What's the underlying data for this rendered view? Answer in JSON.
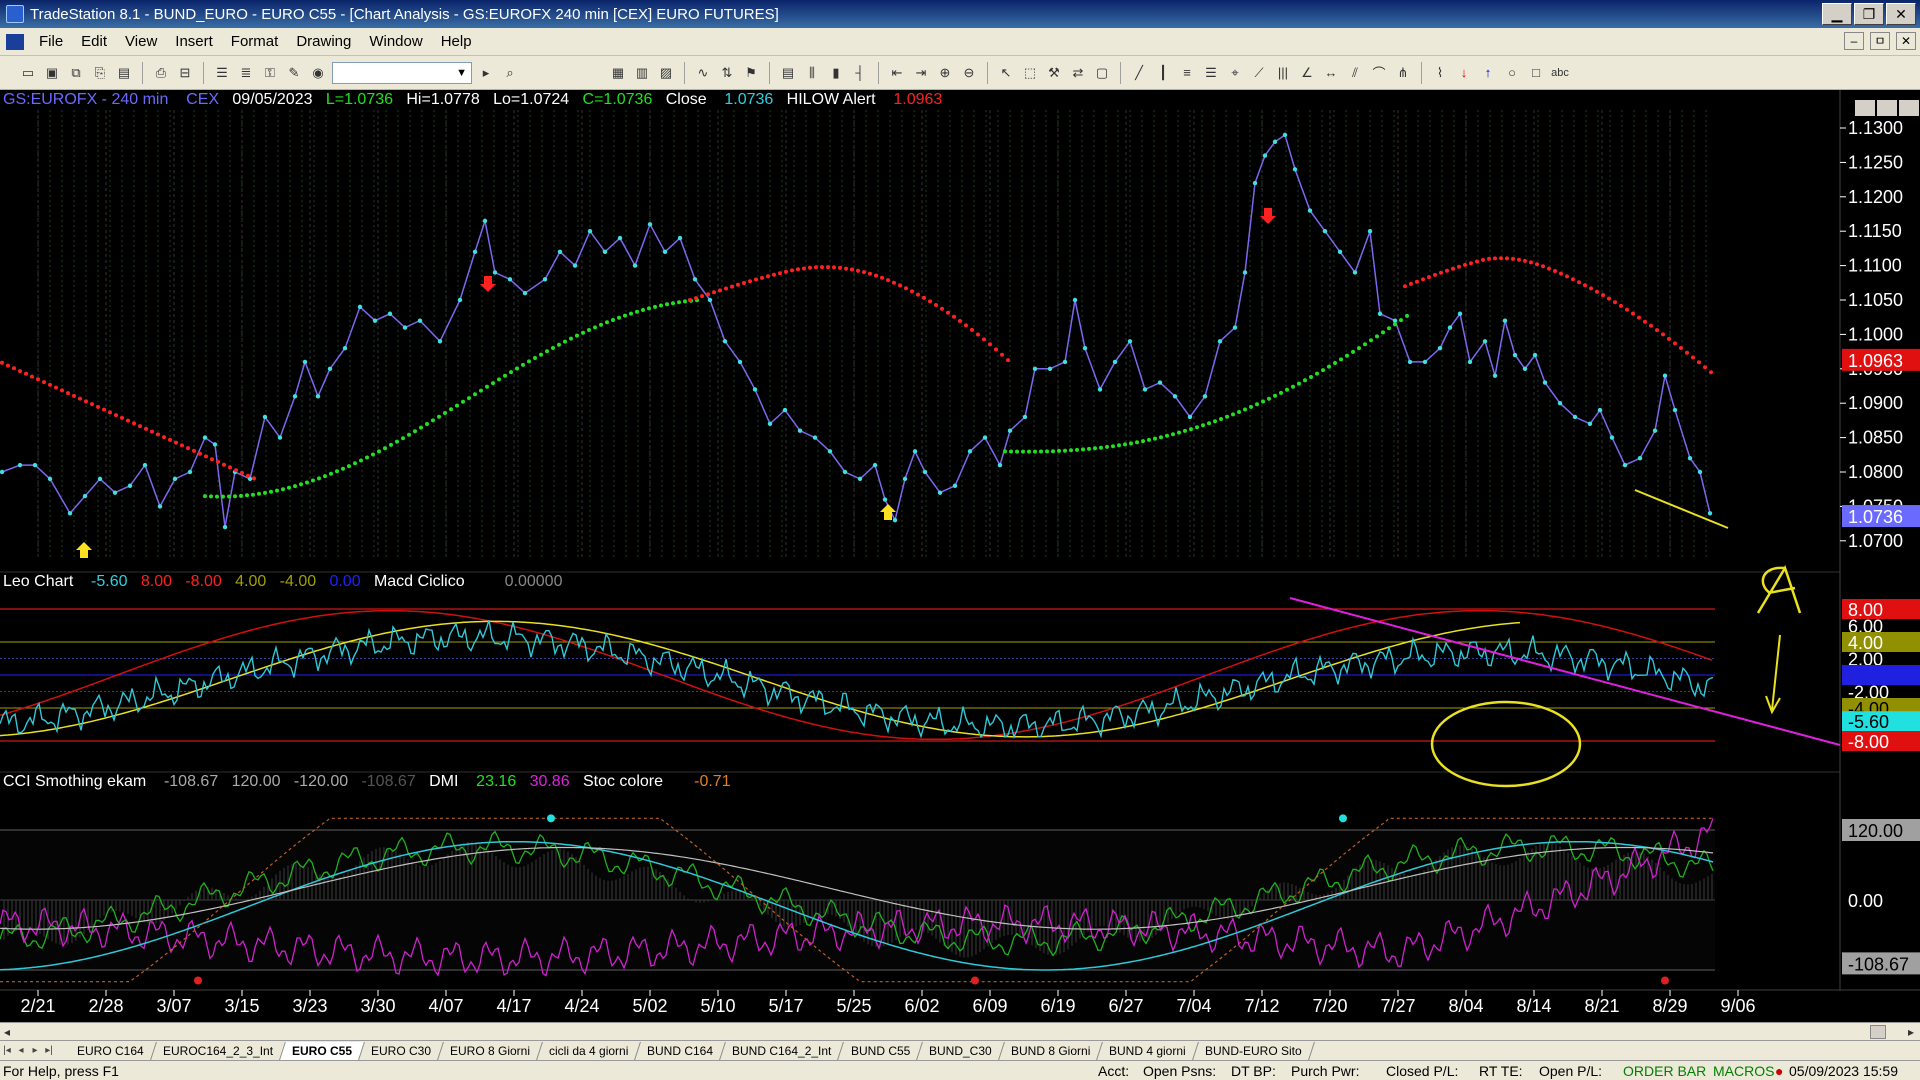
{
  "window": {
    "title": "TradeStation 8.1 - BUND_EURO - EURO C55 - [Chart Analysis - GS:EUROFX  240 min  [CEX] EURO FUTURES]",
    "min_label": "▁",
    "max_label": "❐",
    "close_label": "✕"
  },
  "menu": [
    "File",
    "Edit",
    "View",
    "Insert",
    "Format",
    "Drawing",
    "Window",
    "Help"
  ],
  "mdi_controls": [
    "–",
    "ㅁ",
    "✕"
  ],
  "toolbar": {
    "symbol_value": "",
    "icons": [
      "new-icon",
      "open-icon",
      "copy-icon",
      "paste-icon",
      "save-icon",
      "print-icon",
      "print-preview-icon",
      "layout-icon",
      "layout2-icon",
      "lock-icon",
      "tools-icon",
      "globe-icon"
    ]
  },
  "chart": {
    "symbol": "GS:EUROFX - 240 min",
    "exchange": "CEX",
    "date": "09/05/2023",
    "low_open": "L=1.0736",
    "hi": "Hi=1.0778",
    "lo": "Lo=1.0724",
    "close_c": "C=1.0736",
    "close_label": "Close",
    "close_value": "1.0736",
    "hilow_label": "HILOW Alert",
    "hilow_value": "1.0963",
    "price_axis": [
      "1.1300",
      "1.1250",
      "1.1200",
      "1.1150",
      "1.1100",
      "1.1050",
      "1.1000",
      "1.0950",
      "1.0900",
      "1.0850",
      "1.0800",
      "1.0750",
      "1.0700"
    ],
    "price_tag_red": "1.0963",
    "price_tag_blue": "1.0736"
  },
  "leo_panel": {
    "label": "Leo Chart",
    "v1": "-5.60",
    "v2": "8.00",
    "v3": "-8.00",
    "v4": "4.00",
    "v5": "-4.00",
    "v6": "0.00",
    "macd_label": "Macd Ciclico",
    "macd_value": "0.00000",
    "axis": [
      "8.00",
      "6.00",
      "4.00",
      "2.00",
      "0.00",
      "-2.00",
      "-4.00",
      "-5.60",
      "-8.00"
    ]
  },
  "cci_panel": {
    "label": "CCI Smothing ekam",
    "v1": "-108.67",
    "v2": "120.00",
    "v3": "-120.00",
    "v4": "-108.67",
    "dmi_label": "DMI",
    "dmi_v1": "23.16",
    "dmi_v2": "30.86",
    "stoc_label": "Stoc colore",
    "stoc_value": "-0.71",
    "axis": [
      "120.00",
      "0.00",
      "-108.67"
    ]
  },
  "annotation_letter": "A",
  "date_axis": [
    "2/21",
    "2/28",
    "3/07",
    "3/15",
    "3/23",
    "3/30",
    "4/07",
    "4/17",
    "4/24",
    "5/02",
    "5/10",
    "5/17",
    "5/25",
    "6/02",
    "6/09",
    "6/19",
    "6/27",
    "7/04",
    "7/12",
    "7/20",
    "7/27",
    "8/04",
    "8/14",
    "8/21",
    "8/29",
    "9/06"
  ],
  "tabs": [
    "EURO C164",
    "EUROC164_2_3_Int",
    "EURO C55",
    "EURO C30",
    "EURO 8 Giorni",
    "cicli da 4 giorni",
    "BUND C164",
    "BUND C164_2_Int",
    "BUND C55",
    "BUND_C30",
    "BUND 8 Giorni",
    "BUND 4 giorni",
    "BUND-EURO Sito"
  ],
  "active_tab": 2,
  "status": {
    "help": "For Help, press F1",
    "acct": "Acct:",
    "open_psns": "Open Psns:",
    "dt_bp": "DT BP:",
    "purch_pwr": "Purch Pwr:",
    "closed_pl": "Closed P/L:",
    "rt_te": "RT TE:",
    "open_pl": "Open P/L:",
    "order_bar": "ORDER BAR",
    "macros": "MACROS",
    "datetime": "05/09/2023 15:59"
  },
  "colors": {
    "price_line": "#7b68ee",
    "price_dots": "#40e0e0",
    "red_wave": "#ff2020",
    "green_wave": "#20e020",
    "cyan": "#30c8d8",
    "yellow": "#e8e020",
    "magenta": "#e020e0"
  }
}
